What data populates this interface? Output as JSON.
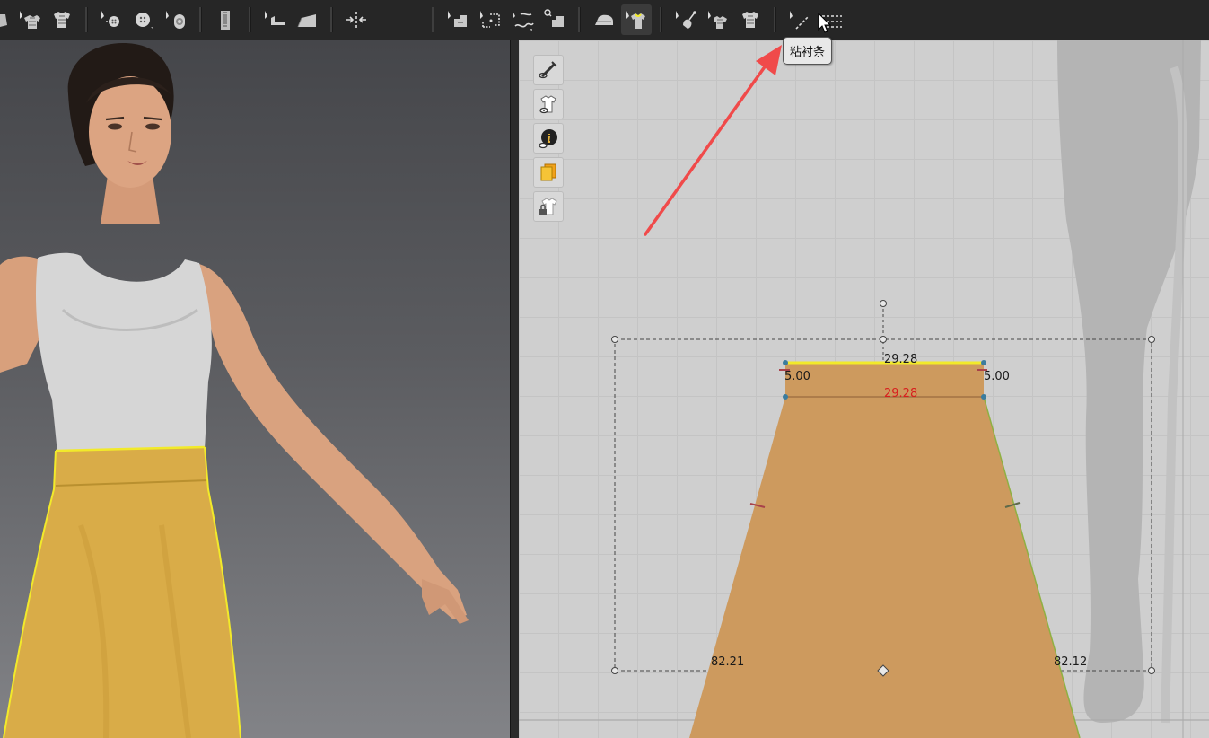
{
  "toolbar": {
    "tooltip_label": "粘衬条",
    "groups": [
      {
        "name": "group-1",
        "icons": [
          "sewing-tool-icon",
          "select-garment-icon",
          "garment-icon"
        ]
      },
      {
        "name": "group-2",
        "icons": [
          "select-button-icon",
          "button-icon",
          "buttonhole-icon"
        ]
      },
      {
        "name": "group-3",
        "icons": [
          "zipper-icon"
        ]
      },
      {
        "name": "group-4",
        "icons": [
          "select-pleat-icon",
          "fold-icon"
        ]
      },
      {
        "name": "group-5",
        "icons": [
          "tack-icon"
        ]
      },
      {
        "name": "group-6",
        "icons": [
          "edit-sewing-icon",
          "segment-sewing-icon",
          "free-sewing-icon",
          "multi-sewing-icon"
        ]
      },
      {
        "name": "group-7",
        "icons": [
          "iron-icon",
          "fusible-tape-icon"
        ]
      },
      {
        "name": "group-8",
        "icons": [
          "select-pin-icon",
          "pin-garment-icon",
          "garment-alt-icon"
        ]
      },
      {
        "name": "group-9",
        "icons": [
          "line-tool-icon",
          "measure-tool-icon"
        ]
      }
    ]
  },
  "colors": {
    "skirt_3d": "#d9ac48",
    "pattern_fill": "#cd9a5e",
    "highlight_edge": "#f2ea2a",
    "annotation_arrow": "#f04a4a",
    "red_measure": "#d81e1e"
  },
  "pattern": {
    "measurements": {
      "top_width": "29.28",
      "inner_width": "29.28",
      "left_height": "5.00",
      "right_height": "5.00",
      "left_side": "82.21",
      "right_side": "82.12"
    }
  },
  "side_tools": [
    "show-stitch-icon",
    "show-garment-icon",
    "info-icon",
    "texture-icon",
    "lock-garment-icon"
  ]
}
